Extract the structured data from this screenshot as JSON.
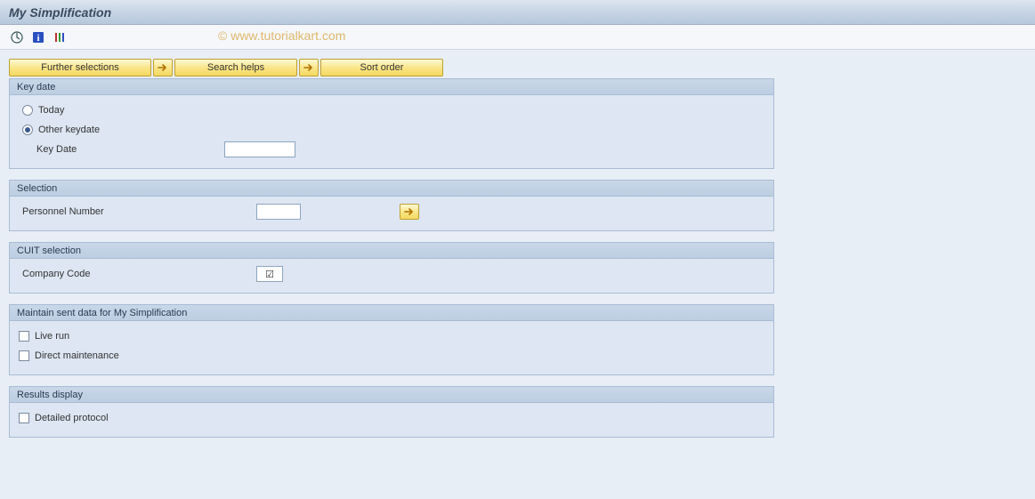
{
  "header": {
    "title": "My Simplification"
  },
  "watermark": "© www.tutorialkart.com",
  "buttons": {
    "further_selections": "Further selections",
    "search_helps": "Search helps",
    "sort_order": "Sort order"
  },
  "groups": {
    "key_date": {
      "title": "Key date",
      "today_label": "Today",
      "other_label": "Other keydate",
      "key_date_label": "Key Date",
      "selected": "other",
      "key_date_value": ""
    },
    "selection": {
      "title": "Selection",
      "personnel_number_label": "Personnel Number",
      "personnel_number_value": ""
    },
    "cuit": {
      "title": "CUIT selection",
      "company_code_label": "Company Code",
      "company_code_check": "☑"
    },
    "maintain": {
      "title": "Maintain sent data for My Simplification",
      "live_run_label": "Live run",
      "direct_maint_label": "Direct maintenance",
      "live_run_checked": false,
      "direct_maint_checked": false
    },
    "results": {
      "title": "Results display",
      "detailed_label": "Detailed protocol",
      "detailed_checked": false
    }
  }
}
